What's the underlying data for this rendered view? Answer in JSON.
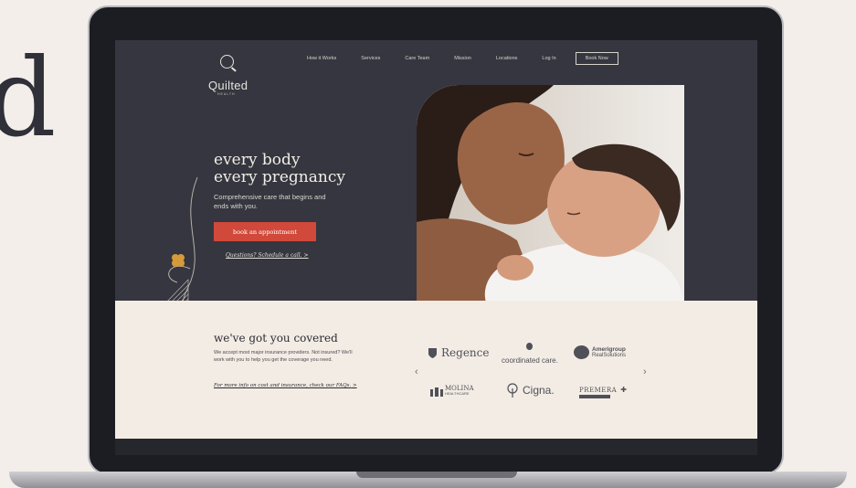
{
  "background_text": "d",
  "site": {
    "logo_name": "Quilted",
    "logo_sub": "HEALTH"
  },
  "nav": {
    "items": [
      "How it Works",
      "Services",
      "Care Team",
      "Mission",
      "Locations",
      "Log In"
    ],
    "book_now": "Book Now"
  },
  "hero": {
    "title_line1": "every body",
    "title_line2": "every pregnancy",
    "subtitle": "Comprehensive care that begins and ends with you.",
    "cta": "book an appointment",
    "questions_link": "Questions? Schedule a call.",
    "chevron": ">"
  },
  "coverage": {
    "title": "we've got you covered",
    "text": "We accept most major insurance providers. Not insured? We'll work with you to help you get the coverage you need.",
    "faq_link": "For more info on cost and insurance, check our FAQs.",
    "chevron": ">",
    "prev_arrow": "‹",
    "next_arrow": "›",
    "logos": {
      "regence": "Regence",
      "coordinated_care": "coordinated care.",
      "amerigroup_line1": "Amerigroup",
      "amerigroup_line2": "RealSolutions",
      "molina_line1": "MOLINA",
      "molina_line2": "HEALTHCARE",
      "cigna": "Cigna.",
      "premera": "PREMERA"
    }
  },
  "colors": {
    "hero_bg": "#35363f",
    "cta": "#d0493b",
    "lower_bg": "#f3ece4"
  }
}
